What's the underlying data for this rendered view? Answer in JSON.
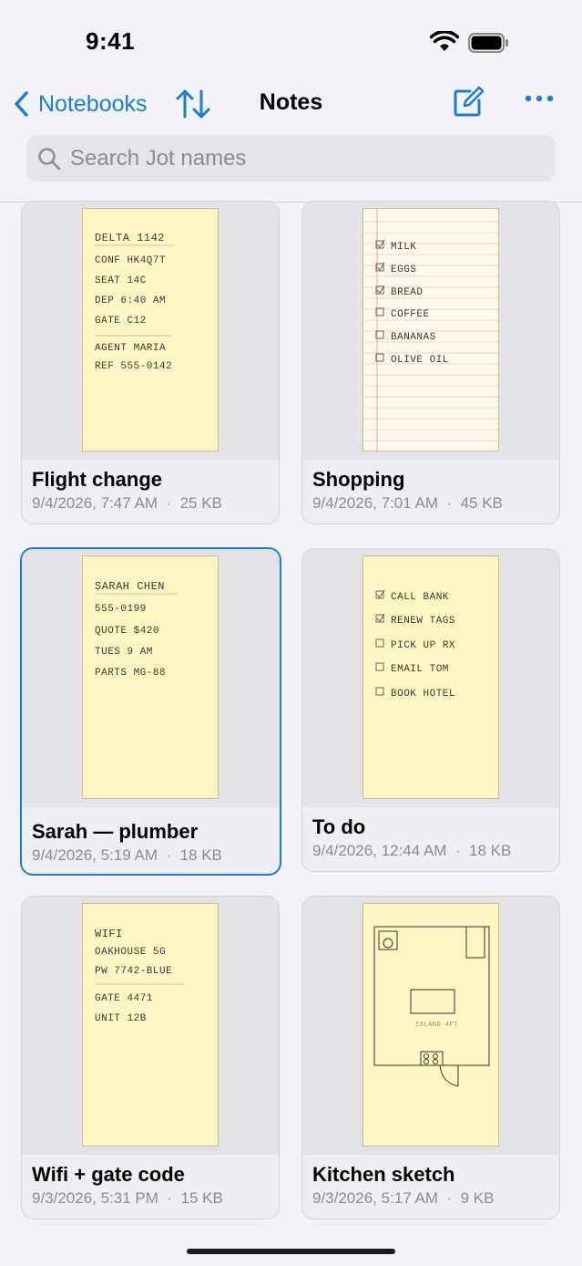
{
  "status_bar": {
    "time": "9:41",
    "wifi_icon": "wifi-icon",
    "battery_icon": "battery-icon"
  },
  "nav": {
    "back_label": "Notebooks",
    "title": "Notes",
    "sort_icon": "sort-arrows-icon",
    "compose_icon": "compose-icon",
    "more_icon": "ellipsis-icon"
  },
  "search": {
    "placeholder": "Search Jot names",
    "value": ""
  },
  "accent_color": "#1a7ed6",
  "notes": [
    {
      "name": "Flight change",
      "date": "9/4/2026, 7:47 AM",
      "size": "25 KB",
      "selected": false,
      "sketch_lines": [
        "DELTA 1142",
        "CONF HK4Q7T",
        "SEAT 14C",
        "DEP 6:40 AM",
        "GATE C12",
        "AGENT MARIA",
        "REF 555-0142"
      ]
    },
    {
      "name": "Shopping",
      "date": "9/4/2026, 7:01 AM",
      "size": "45 KB",
      "selected": false,
      "sketch_lines": [
        "MILK",
        "EGGS",
        "BREAD",
        "COFFEE",
        "BANANAS",
        "OLIVE OIL"
      ]
    },
    {
      "name": "Sarah — plumber",
      "date": "9/4/2026, 5:19 AM",
      "size": "18 KB",
      "selected": true,
      "sketch_lines": [
        "SARAH CHEN",
        "555-0199",
        "QUOTE $420",
        "TUES 9 AM",
        "PARTS MG-88"
      ]
    },
    {
      "name": "To do",
      "date": "9/4/2026, 12:44 AM",
      "size": "18 KB",
      "selected": false,
      "sketch_lines": [
        "CALL BANK",
        "RENEW TAGS",
        "PICK UP RX",
        "EMAIL TOM",
        "BOOK HOTEL"
      ]
    },
    {
      "name": "Wifi + gate code",
      "date": "9/3/2026, 5:31 PM",
      "size": "15 KB",
      "selected": false,
      "sketch_lines": [
        "WIFI",
        "OAKHOUSE 5G",
        "PW 7742-BLUE",
        "GATE 4471",
        "UNIT 12B"
      ]
    },
    {
      "name": "Kitchen sketch",
      "date": "9/3/2026, 5:17 AM",
      "size": "9 KB",
      "selected": false,
      "sketch_lines": [
        "ISLAND 4FT"
      ]
    }
  ],
  "separator": "·"
}
